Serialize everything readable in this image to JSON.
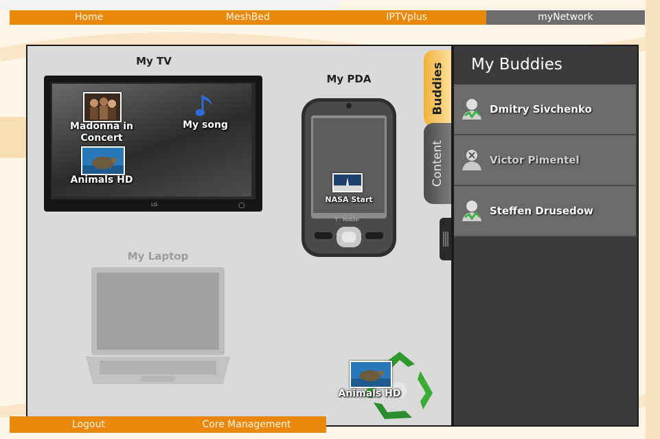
{
  "top_nav": {
    "tabs": [
      {
        "label": "Home"
      },
      {
        "label": "MeshBed"
      },
      {
        "label": "IPTVplus"
      },
      {
        "label": "myNetwork"
      }
    ],
    "active_tab": "myNetwork"
  },
  "canvas": {
    "tv": {
      "label": "My TV",
      "brand": "LG",
      "items": [
        {
          "label": "Madonna in Concert",
          "icon": "concert-thumbnail"
        },
        {
          "label": "My song",
          "icon": "music-note-icon"
        },
        {
          "label": "Animals HD",
          "icon": "turtle-thumbnail"
        }
      ]
    },
    "pda": {
      "label": "My PDA",
      "brand": "T · Mobile·",
      "items": [
        {
          "label": "NASA Start",
          "icon": "shuttle-thumbnail"
        }
      ]
    },
    "laptop": {
      "label": "My Laptop"
    },
    "recycle": {
      "item_label": "Animals HD",
      "icon": "recycle-icon"
    }
  },
  "side_tabs": {
    "buddies": "Buddies",
    "content": "Content"
  },
  "buddies_panel": {
    "title": "My Buddies",
    "buddies": [
      {
        "name": "Dmitry Sivchenko",
        "status": "online"
      },
      {
        "name": "Victor Pimentel",
        "status": "offline"
      },
      {
        "name": "Steffen Drusedow",
        "status": "online"
      }
    ]
  },
  "bottom_nav": {
    "tabs": [
      {
        "label": "Logout"
      },
      {
        "label": "Core Management"
      }
    ]
  },
  "colors": {
    "nav_orange": "#e8890e",
    "nav_active": "#6d6d6d",
    "canvas_bg": "#dadada",
    "panel_bg": "#3b3b3b",
    "buddy_row": "#6b6b6b",
    "online_green": "#3cb043"
  }
}
